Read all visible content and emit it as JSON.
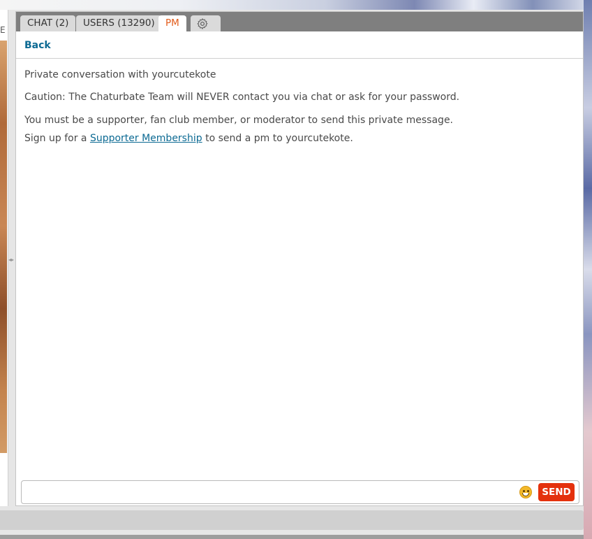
{
  "left_panel": {
    "edge_glyph": "E"
  },
  "tabs": [
    {
      "label": "CHAT (2)"
    },
    {
      "label": "USERS (13290)"
    },
    {
      "label": "PM"
    }
  ],
  "settings_icon": "gear-icon",
  "back_label": "Back",
  "conversation": {
    "header": "Private conversation with yourcutekote",
    "caution": "Caution: The Chaturbate Team will NEVER contact you via chat or ask for your password.",
    "restriction": "You must be a supporter, fan club member, or moderator to send this private message.",
    "signup_prefix": "Sign up for a ",
    "signup_link": "Supporter Membership",
    "signup_suffix": " to send a pm to yourcutekote."
  },
  "input": {
    "value": "",
    "placeholder": ""
  },
  "emoji_icon": "smiley-icon",
  "send_label": "SEND",
  "colors": {
    "accent_tab": "#e25c1b",
    "link": "#0c6a93",
    "send_button": "#e4310d"
  }
}
